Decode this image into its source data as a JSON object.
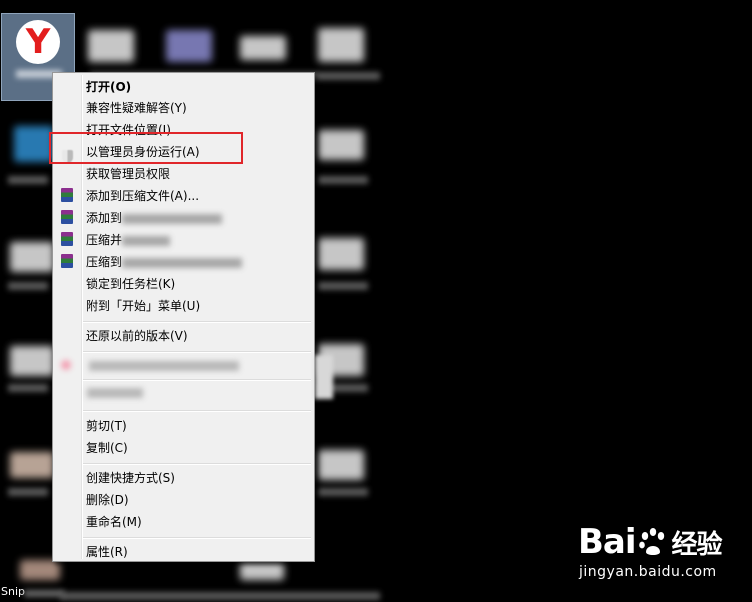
{
  "desktop": {
    "selected_icon": {
      "glyph": "Y",
      "accent": "#e31d1d"
    },
    "bottom_label": "Snip"
  },
  "context_menu": {
    "items": [
      {
        "label": "打开(O)",
        "bold": true
      },
      {
        "label": "兼容性疑难解答(Y)"
      },
      {
        "label": "打开文件位置(I)"
      },
      {
        "label": "以管理员身份运行(A)",
        "icon": "shield-icon",
        "highlighted": true
      },
      {
        "label": "获取管理员权限"
      },
      {
        "label": "添加到压缩文件(A)...",
        "icon": "winrar-icon"
      },
      {
        "label": "添加到",
        "icon": "winrar-icon"
      },
      {
        "label": "压缩并",
        "icon": "winrar-icon"
      },
      {
        "label": "压缩到",
        "icon": "winrar-icon"
      },
      {
        "label": "锁定到任务栏(K)"
      },
      {
        "label": "附到「开始」菜单(U)"
      },
      {
        "label": "还原以前的版本(V)"
      },
      {
        "label": "剪切(T)"
      },
      {
        "label": "复制(C)"
      },
      {
        "label": "创建快捷方式(S)"
      },
      {
        "label": "删除(D)"
      },
      {
        "label": "重命名(M)"
      },
      {
        "label": "属性(R)"
      }
    ],
    "highlight_color": "#e0262a"
  },
  "watermark": {
    "logo_left": "Bai",
    "logo_right": "经验",
    "url": "jingyan.baidu.com"
  }
}
